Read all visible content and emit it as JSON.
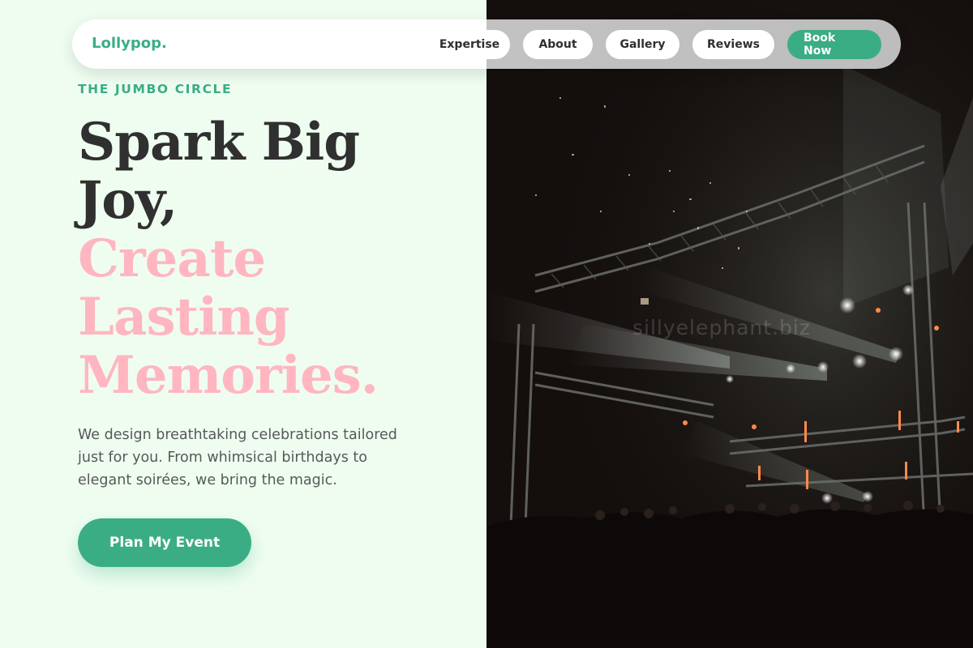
{
  "nav": {
    "brand": "Lollypop.",
    "links": [
      "Expertise",
      "About",
      "Gallery",
      "Reviews"
    ],
    "cta": "Book Now"
  },
  "hero": {
    "eyebrow": "THE JUMBO CIRCLE",
    "headline_dark": [
      "Spark Big",
      "Joy,"
    ],
    "headline_pink": [
      "Create",
      "Lasting",
      "Memories."
    ],
    "description": "We design breathtaking celebrations tailored just for you. From whimsical birthdays to elegant soirées, we bring the magic.",
    "button": "Plan My Event"
  },
  "photo": {
    "subject": "concert-stage-lights-photo",
    "watermark": "sillyelephant.biz"
  },
  "colors": {
    "accent": "#3bad85",
    "pink": "#ffb6c1",
    "background": "#effdf1",
    "text_dark": "#2f302f"
  }
}
